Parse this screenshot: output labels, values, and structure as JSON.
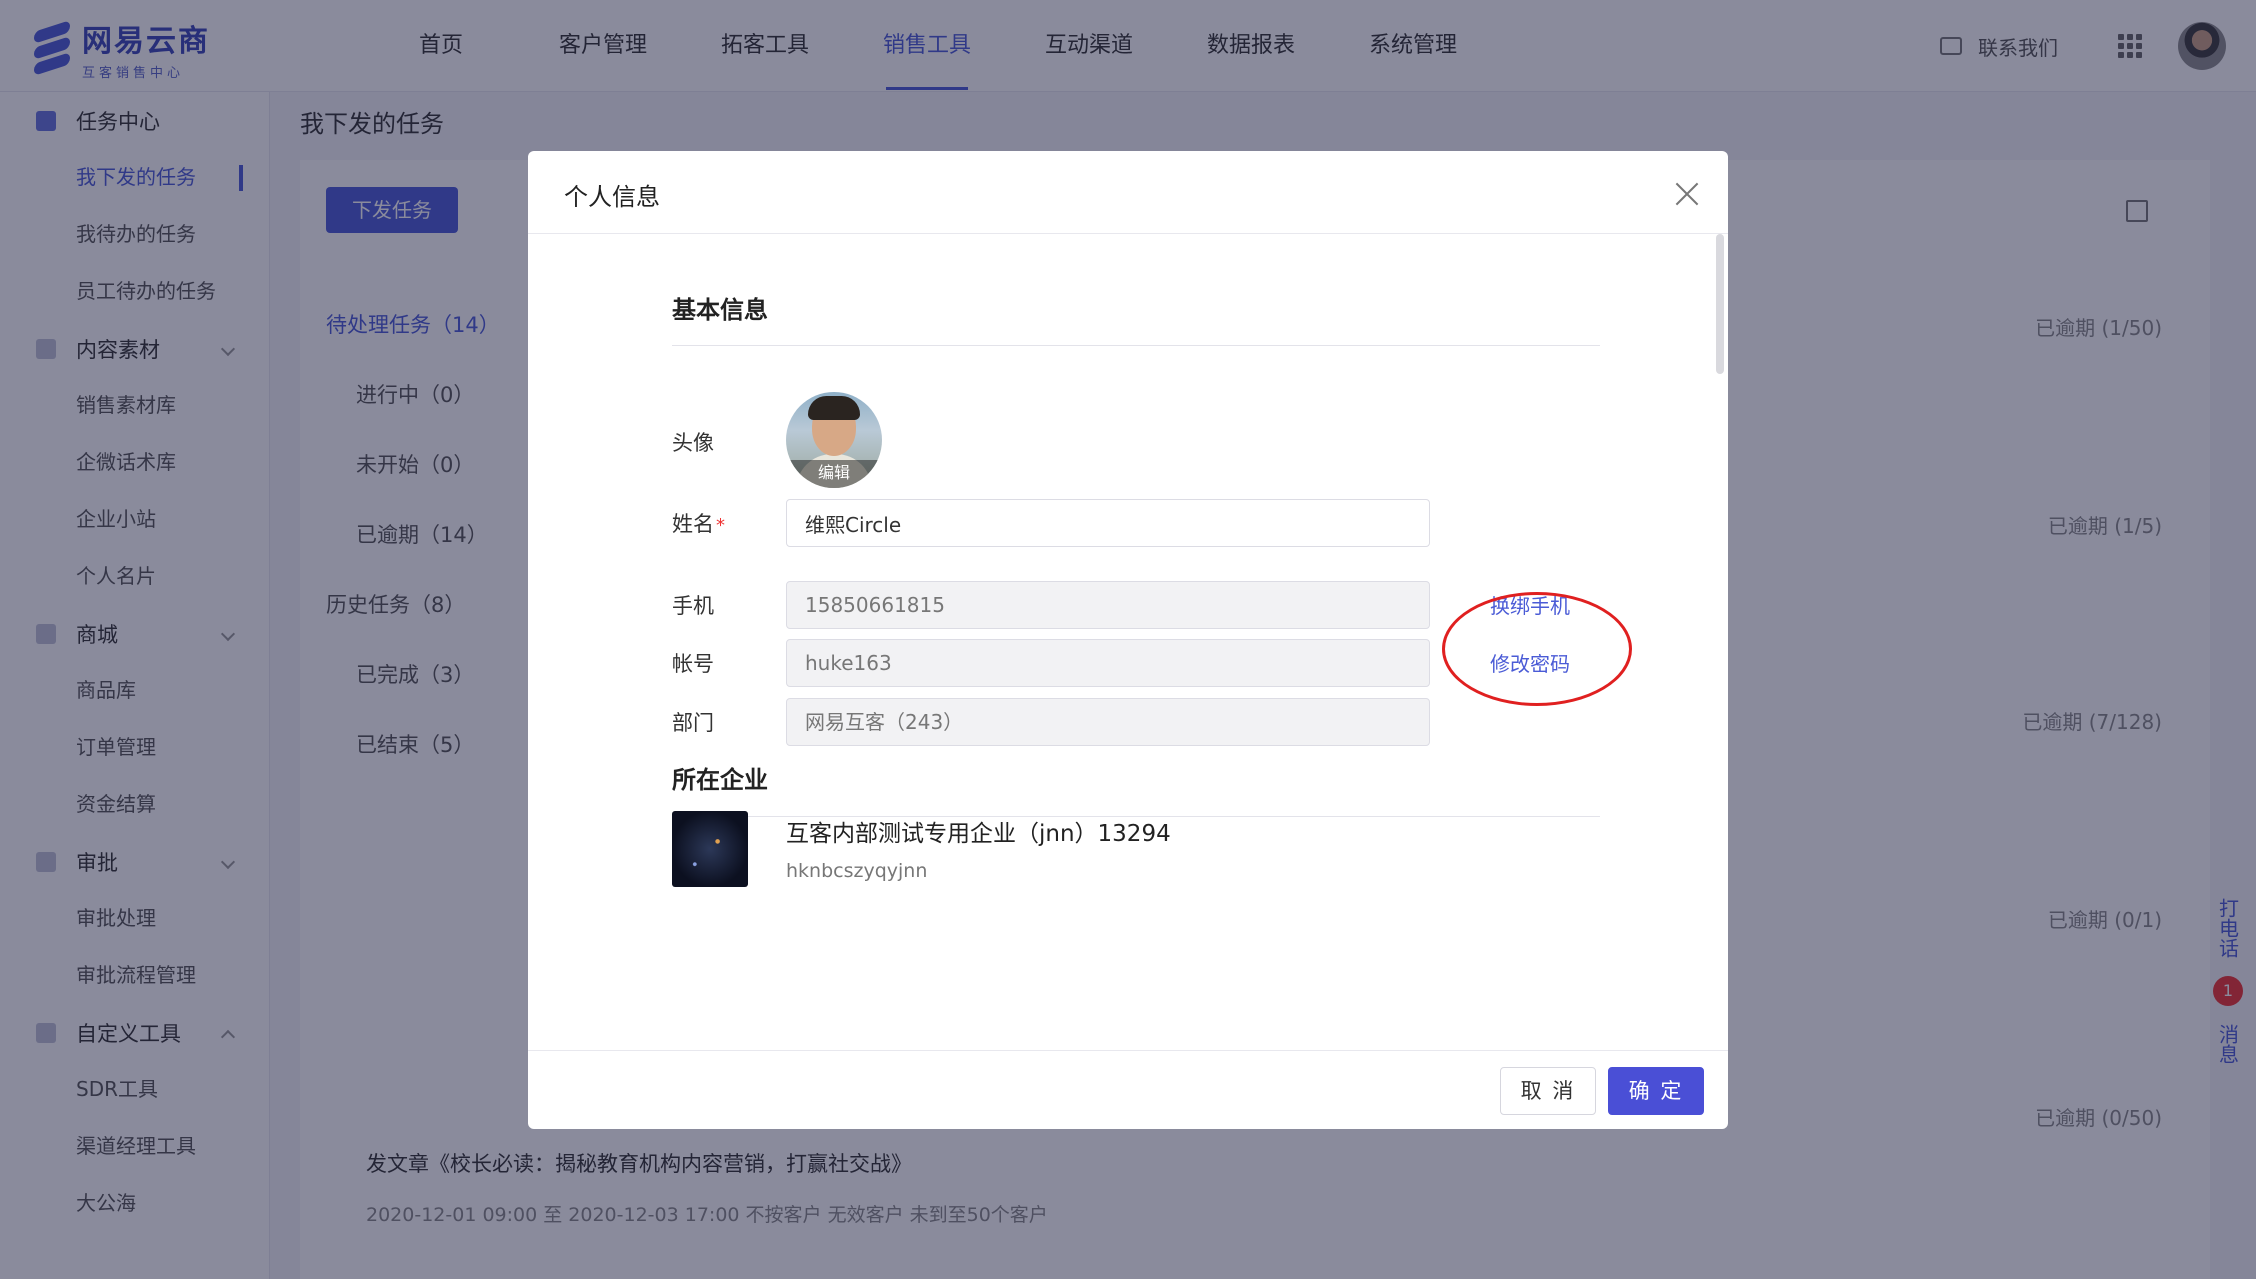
{
  "app": {
    "logo_title": "网易云商",
    "logo_sub": "互客销售中心"
  },
  "nav": [
    "首页",
    "客户管理",
    "拓客工具",
    "销售工具",
    "互动渠道",
    "数据报表",
    "系统管理"
  ],
  "nav_active": 3,
  "top_right": {
    "contact": "联系我们"
  },
  "sidebar": {
    "groups": [
      {
        "label": "任务中心",
        "items": [
          "我下发的任务",
          "我待办的任务",
          "员工待办的任务"
        ]
      },
      {
        "label": "内容素材",
        "items": [
          "销售素材库",
          "企微话术库",
          "企业小站",
          "个人名片"
        ]
      },
      {
        "label": "商城",
        "items": [
          "商品库",
          "订单管理",
          "资金结算"
        ]
      },
      {
        "label": "审批",
        "items": [
          "审批处理",
          "审批流程管理"
        ]
      },
      {
        "label": "自定义工具",
        "items": [
          "SDR工具",
          "渠道经理工具",
          "大公海"
        ]
      }
    ]
  },
  "page": {
    "title": "我下发的任务",
    "issue_button": "下发任务",
    "task_tree": [
      {
        "label": "待处理任务（14）",
        "sub": false
      },
      {
        "label": "进行中（0）",
        "sub": true
      },
      {
        "label": "未开始（0）",
        "sub": true
      },
      {
        "label": "已逾期（14）",
        "sub": true
      },
      {
        "label": "历史任务（8）",
        "sub": false
      },
      {
        "label": "已完成（3）",
        "sub": true
      },
      {
        "label": "已结束（5）",
        "sub": true
      }
    ],
    "overdue_labels": [
      "已逾期 (1/50)",
      "已逾期 (1/5)",
      "已逾期 (7/128)",
      "已逾期 (0/1)",
      "已逾期 (0/50)"
    ],
    "bg_task_title": "发文章《校长必读：揭秘教育机构内容营销，打赢社交战》",
    "bg_task_meta": "2020-12-01 09:00 至 2020-12-03 17:00    不按客户    无效客户    未到至50个客户",
    "rail": {
      "call": "打电话",
      "msg": "消息",
      "badge": "1"
    }
  },
  "modal": {
    "title": "个人信息",
    "basic_section": "基本信息",
    "fields": {
      "avatar_label": "头像",
      "avatar_edit": "编辑",
      "name_label": "姓名",
      "name_required": "*",
      "name_value": "维熙Circle",
      "phone_label": "手机",
      "phone_value": "15850661815",
      "phone_link": "换绑手机",
      "account_label": "帐号",
      "account_value": "huke163",
      "password_link": "修改密码",
      "dept_label": "部门",
      "dept_value": "网易互客（243）"
    },
    "enterprise_section": "所在企业",
    "enterprise": {
      "name": "互客内部测试专用企业（jnn）13294",
      "code": "hknbcszyqyjnn"
    },
    "cancel": "取 消",
    "ok": "确 定"
  },
  "colors": {
    "brand": "#4a5bd6",
    "primary_button": "#4a4fd6",
    "highlight_ring": "#e02020",
    "required": "#e33333"
  }
}
